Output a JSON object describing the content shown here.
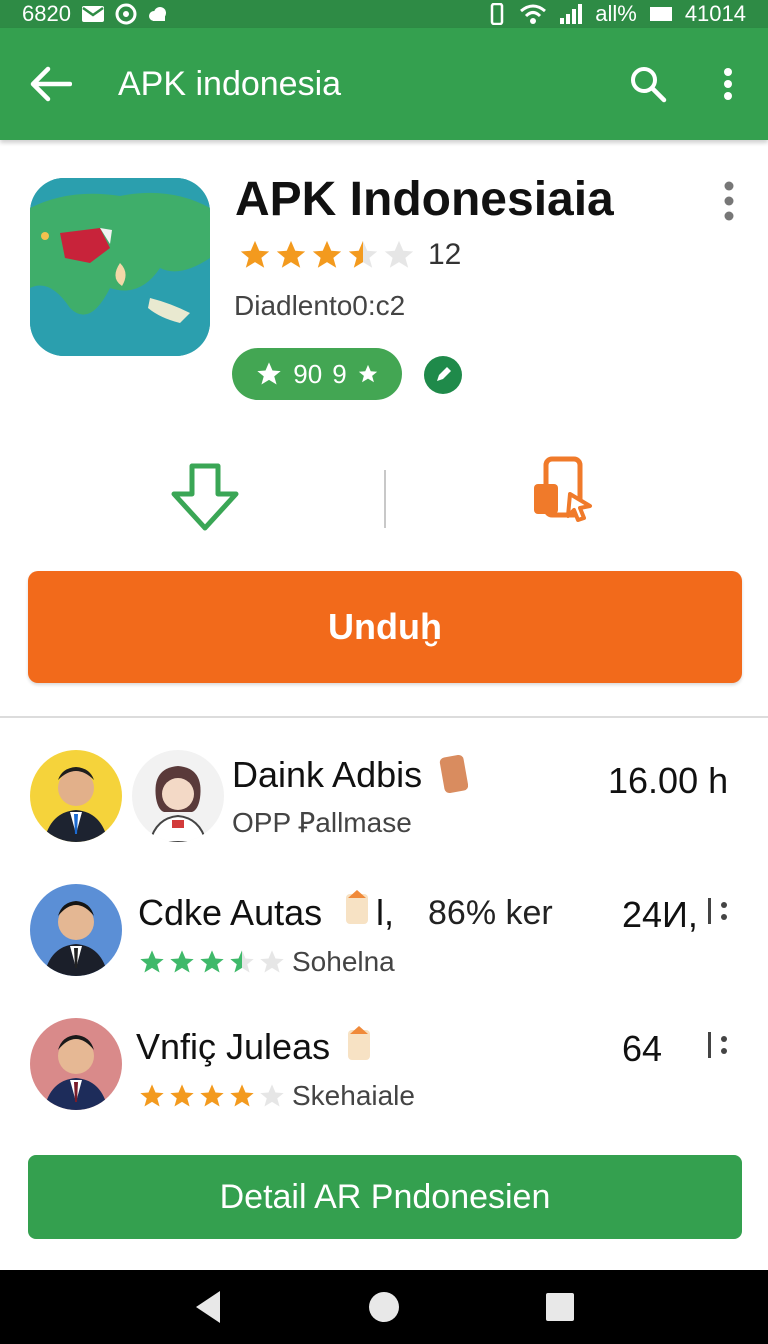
{
  "status_bar": {
    "time": "6820",
    "right_text": "all%",
    "clock_right": "41014"
  },
  "app_bar": {
    "title": "APK indonesia"
  },
  "app": {
    "name": "APK Indonesiaia",
    "rating_count": "12",
    "rating_stars": 3.5,
    "developer": "Diadlento0:c2",
    "badge_value": "90",
    "badge_extra": "9"
  },
  "install_button": {
    "label": "Unduḫ"
  },
  "list": [
    {
      "name": "Daink Adbis",
      "subtitle": "OPP Ꝑallmase",
      "value": "16.00 h",
      "percent": "",
      "stars": 0,
      "star_color": ""
    },
    {
      "name": "Cdke Autas",
      "suffix": "l,",
      "percent": "86% ker",
      "subtitle": "Sohelna",
      "value": "24И,",
      "stars": 3.5,
      "star_color": "#3fb96a"
    },
    {
      "name": "Vnfiç Juleas",
      "subtitle": "Skehaiale",
      "value": "64",
      "percent": "",
      "stars": 4,
      "star_color": "#f39a1e"
    }
  ],
  "detail_button": {
    "label": "Detail AR Pndonesien"
  },
  "colors": {
    "primary_green": "#34a04f",
    "accent_orange": "#f26a1b",
    "star_orange": "#f39a1e"
  }
}
